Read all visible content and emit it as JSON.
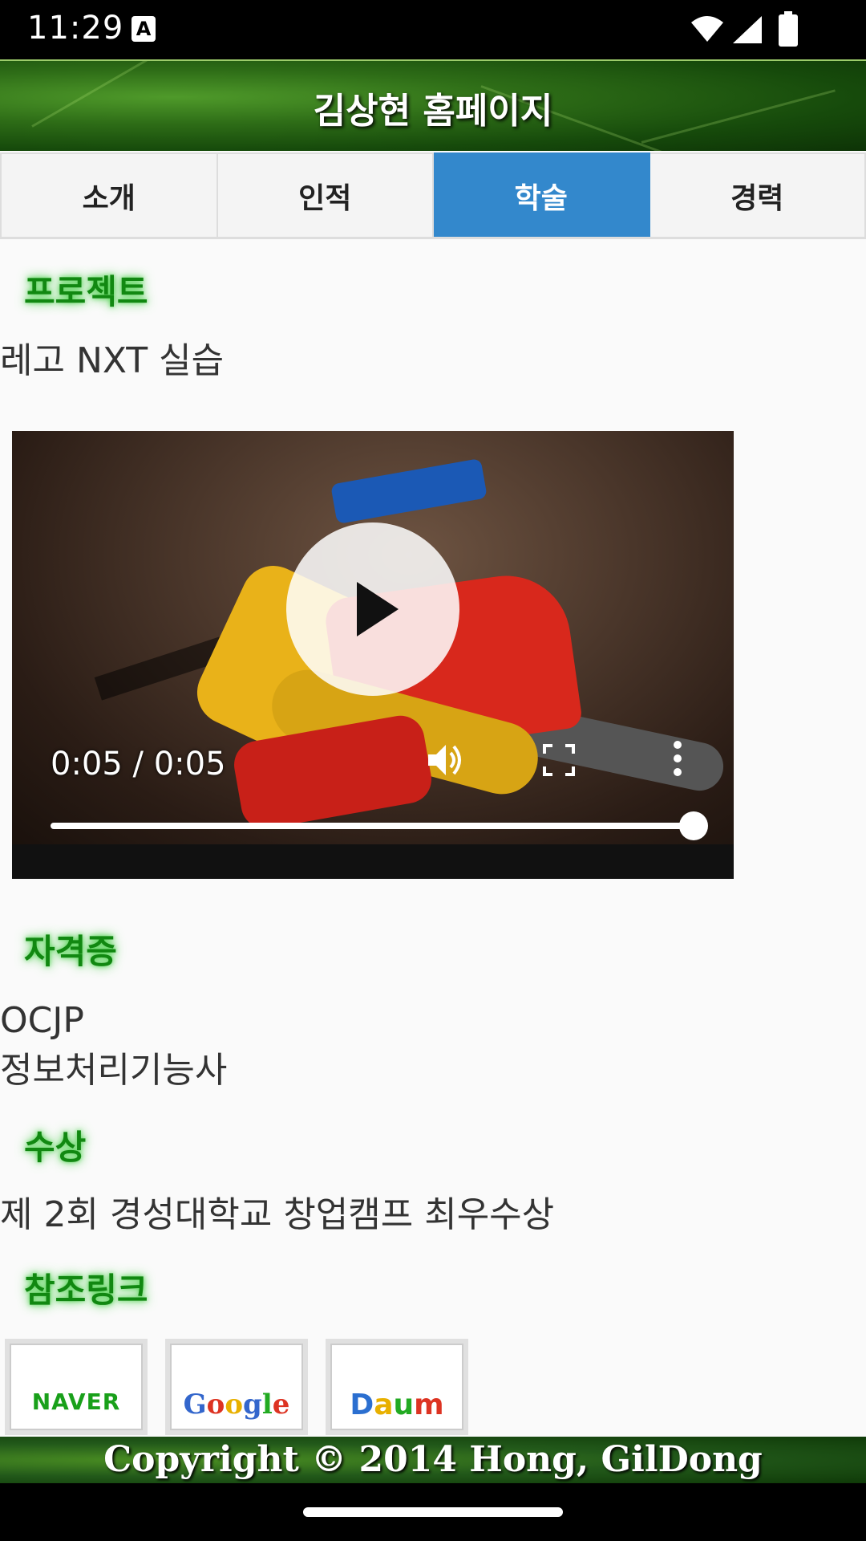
{
  "status_bar": {
    "time": "11:29",
    "notification_icon": "A"
  },
  "header": {
    "title": "김상현 홈페이지"
  },
  "tabs": [
    {
      "label": "소개",
      "active": false
    },
    {
      "label": "인적",
      "active": false
    },
    {
      "label": "학술",
      "active": true
    },
    {
      "label": "경력",
      "active": false
    }
  ],
  "sections": {
    "project": {
      "title": "프로젝트",
      "text": "레고 NXT 실습"
    },
    "certificate": {
      "title": "자격증",
      "items": [
        "OCJP",
        "정보처리기능사"
      ]
    },
    "award": {
      "title": "수상",
      "text": "제 2회 경성대학교 창업캠프 최우수상"
    },
    "links": {
      "title": "참조링크",
      "items": [
        {
          "label": "NAVER",
          "color": "#19a01a"
        },
        {
          "label": "Google"
        },
        {
          "label": "Daum"
        }
      ]
    }
  },
  "video": {
    "time_display": "0:05 / 0:05",
    "progress": 1.0
  },
  "footer": {
    "copyright": "Copyright © 2014 Hong, GilDong"
  },
  "colors": {
    "active_tab": "#3388cc",
    "section_title": "#118811"
  }
}
